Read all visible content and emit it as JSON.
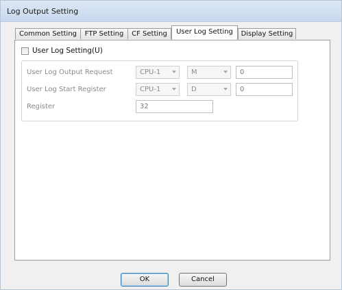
{
  "window": {
    "title": "Log Output Setting"
  },
  "tabs": [
    {
      "label": "Common Setting",
      "active": false
    },
    {
      "label": "FTP Setting",
      "active": false
    },
    {
      "label": "CF Setting",
      "active": false
    },
    {
      "label": "User Log Setting",
      "active": true
    },
    {
      "label": "Display Setting",
      "active": false
    }
  ],
  "user_log": {
    "checkbox_label": "User Log Setting(U)",
    "checked": false,
    "output_request": {
      "label": "User Log Output Request",
      "cpu": "CPU-1",
      "device": "M",
      "value": "0"
    },
    "start_register": {
      "label": "User Log Start Register",
      "cpu": "CPU-1",
      "device": "D",
      "value": "0"
    },
    "register": {
      "label": "Register",
      "value": "32"
    }
  },
  "buttons": {
    "ok": "OK",
    "cancel": "Cancel"
  }
}
